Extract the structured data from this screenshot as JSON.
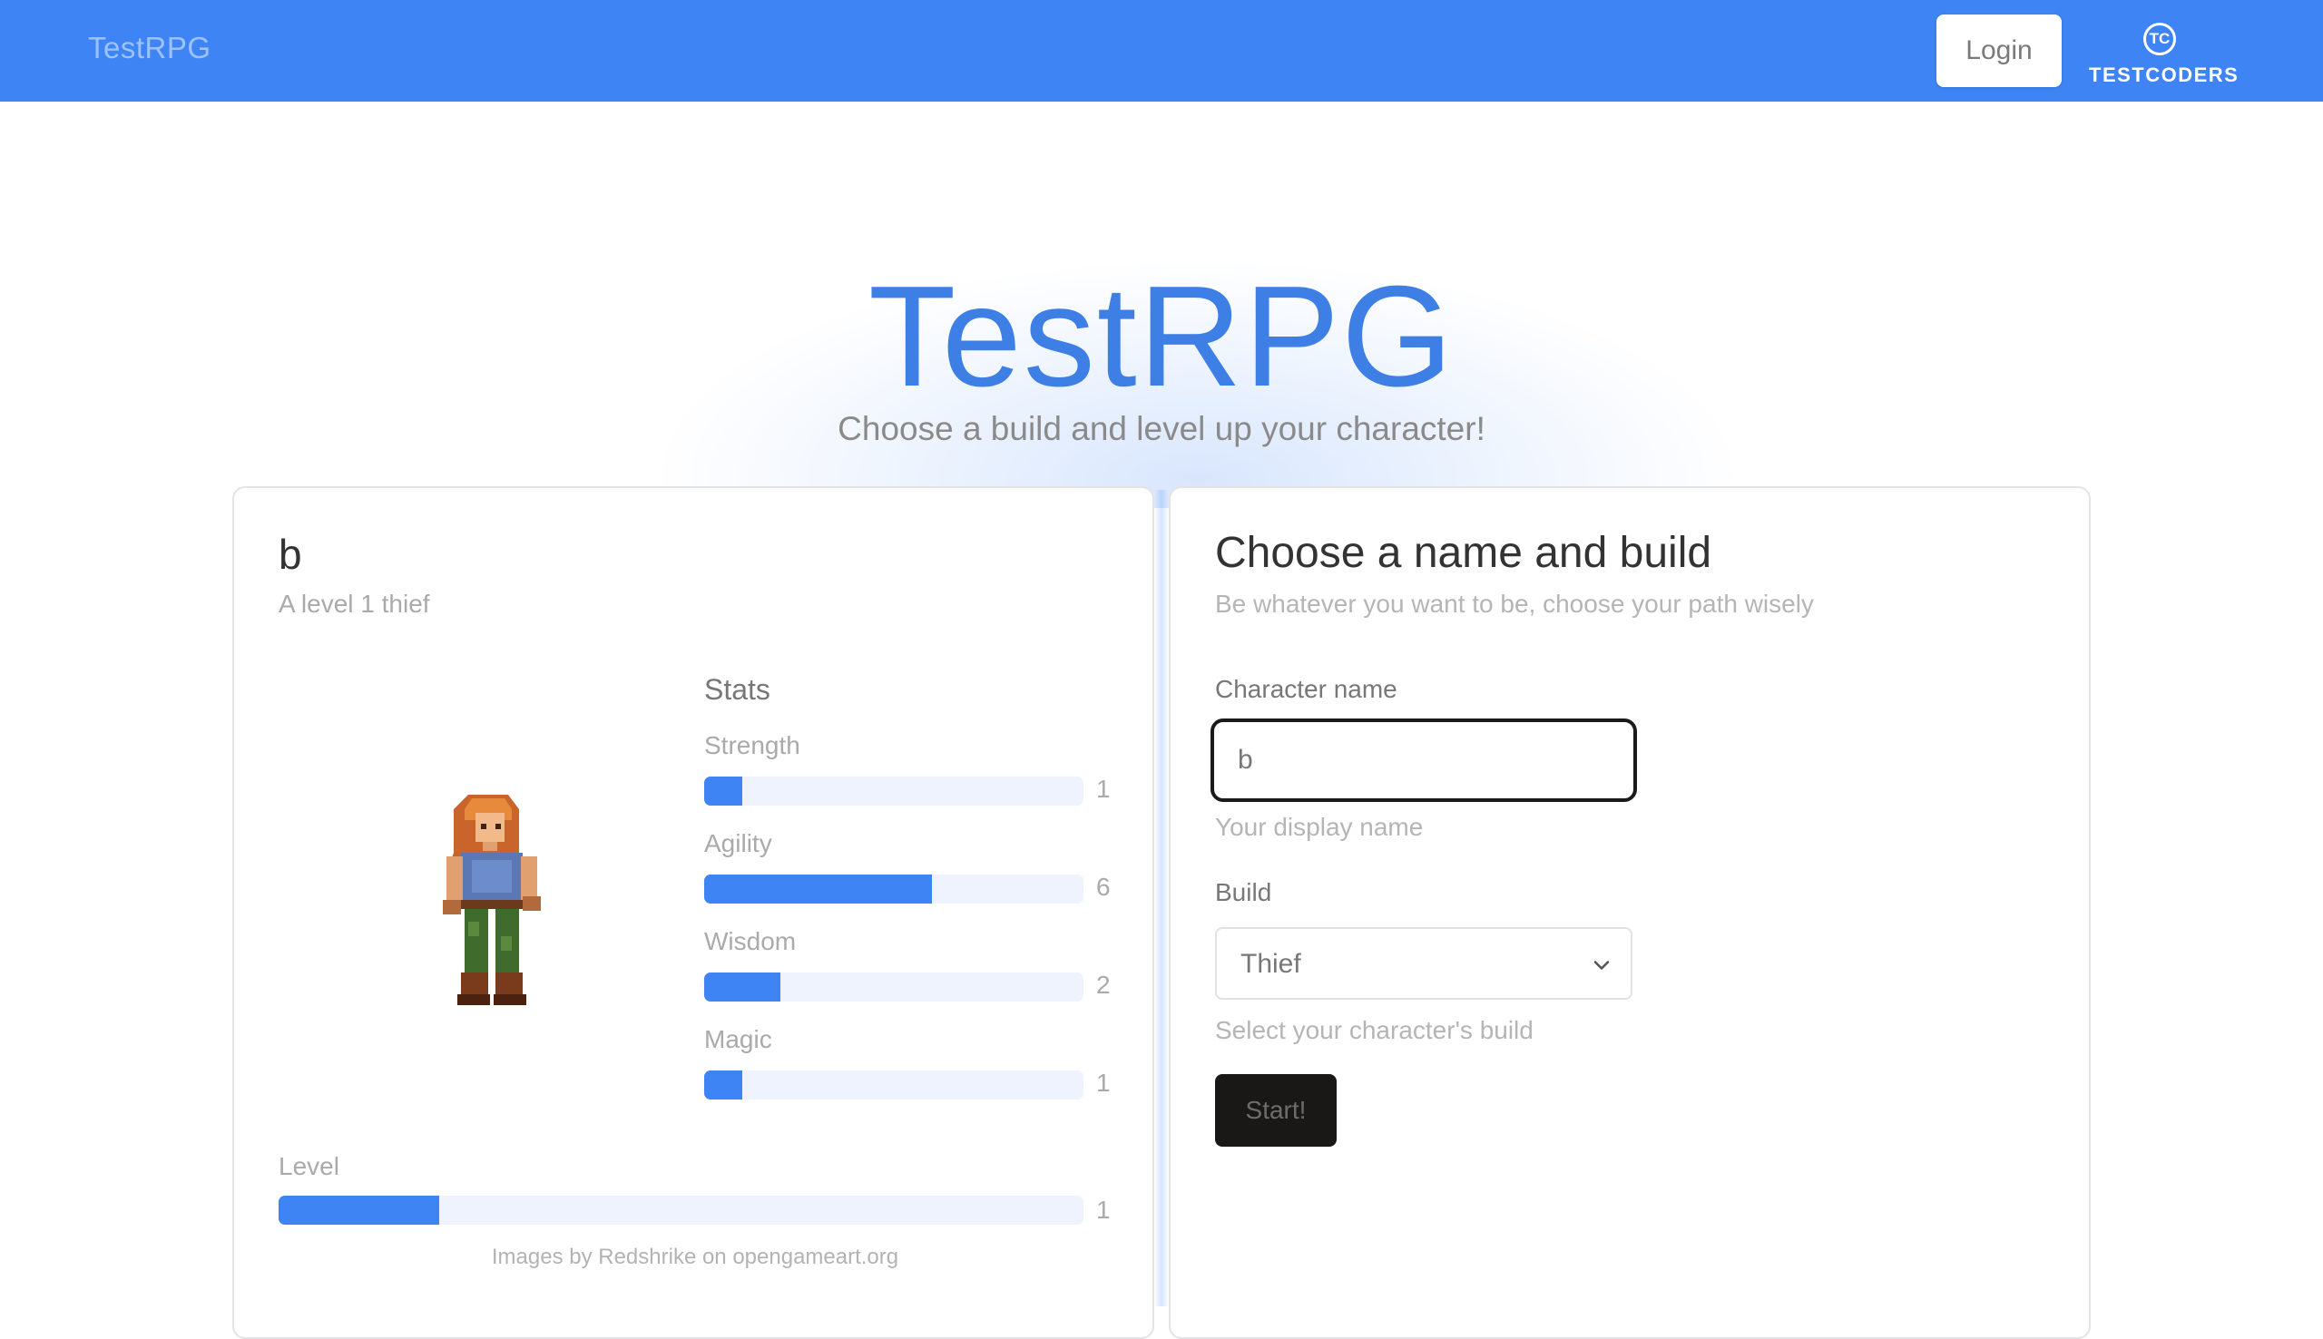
{
  "nav": {
    "brand": "TestRPG",
    "login_label": "Login",
    "logo_monogram": "TC",
    "logo_word": "TESTCODERS"
  },
  "hero": {
    "title": "TestRPG",
    "subtitle": "Choose a build and level up your character!"
  },
  "character": {
    "name": "b",
    "description": "A level 1 thief",
    "sprite_icon": "thief-sprite",
    "stats_title": "Stats",
    "stats": [
      {
        "label": "Strength",
        "value": "1",
        "fill": 0.1
      },
      {
        "label": "Agility",
        "value": "6",
        "fill": 0.6
      },
      {
        "label": "Wisdom",
        "value": "2",
        "fill": 0.2
      },
      {
        "label": "Magic",
        "value": "1",
        "fill": 0.1
      }
    ],
    "level_label": "Level",
    "level_value": "1",
    "level_fill": 0.2,
    "credit": "Images by Redshrike on opengameart.org"
  },
  "form": {
    "title": "Choose a name and build",
    "subtitle": "Be whatever you want to be, choose your path wisely",
    "name_label": "Character name",
    "name_value": "b",
    "name_hint": "Your display name",
    "build_label": "Build",
    "build_value": "Thief",
    "build_hint": "Select your character's build",
    "start_label": "Start!"
  },
  "colors": {
    "accent": "#3e84f4",
    "nav_bg": "#3e84f4",
    "track": "#eef3fd",
    "button_dark": "#1a1816"
  }
}
